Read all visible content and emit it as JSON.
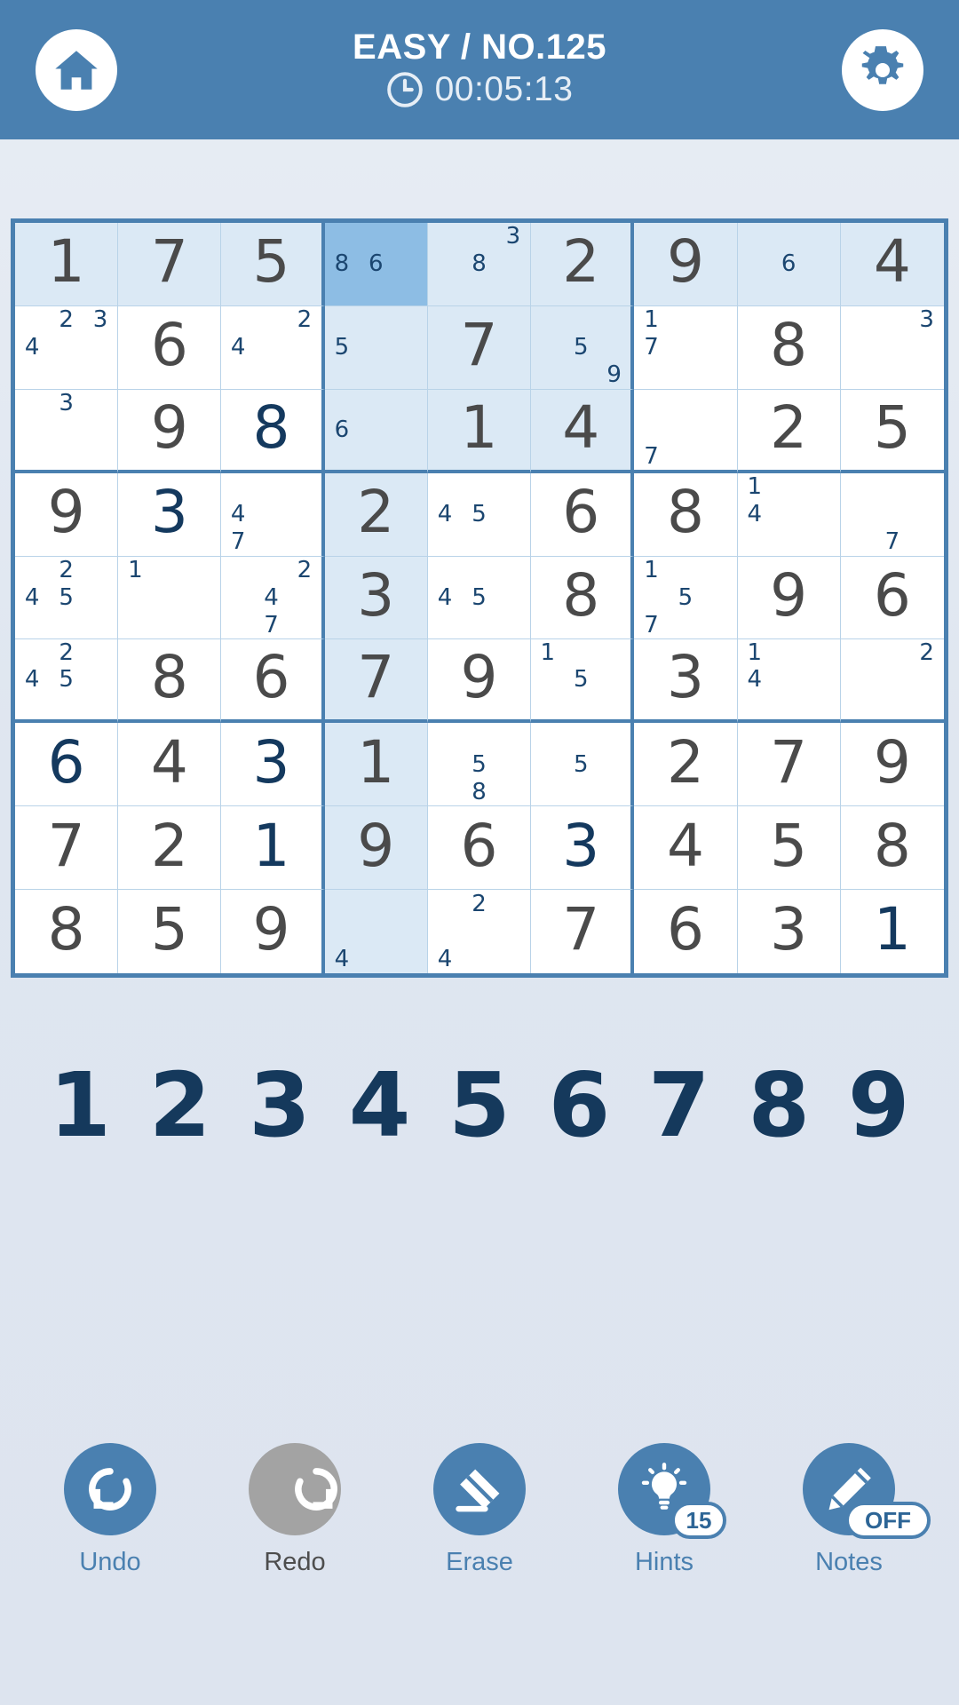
{
  "header": {
    "home_icon": "home-icon",
    "settings_icon": "gear-icon",
    "clock_icon": "clock-icon",
    "title": "EASY / NO.125",
    "timer": "00:05:13"
  },
  "colors": {
    "header_bg": "#4a80b0",
    "grid_border": "#4a80b0",
    "cell_border": "#b9d3e8",
    "peer_highlight": "#dbe9f5",
    "selected": "#8dbde4",
    "given_value": "#4a4a4a",
    "user_value": "#14395e",
    "note": "#1b4670",
    "numpad": "#15395c",
    "disabled": "#a3a3a3"
  },
  "board": {
    "selected_cell": {
      "row": 1,
      "col": 4
    },
    "cells": [
      [
        {
          "v": "1",
          "t": "given"
        },
        {
          "v": "7",
          "t": "given"
        },
        {
          "v": "5",
          "t": "given"
        },
        {
          "notes": [
            null,
            null,
            null,
            "8",
            "6",
            null,
            null,
            null,
            null
          ]
        },
        {
          "notes": [
            null,
            null,
            "3",
            null,
            "8",
            null,
            null,
            null,
            null
          ]
        },
        {
          "v": "2",
          "t": "given"
        },
        {
          "v": "9",
          "t": "given"
        },
        {
          "notes": [
            null,
            null,
            null,
            null,
            "6",
            null,
            null,
            null,
            null
          ]
        },
        {
          "v": "4",
          "t": "given"
        }
      ],
      [
        {
          "notes": [
            null,
            "2",
            "3",
            "4",
            null,
            null,
            null,
            null,
            null
          ]
        },
        {
          "v": "6",
          "t": "given"
        },
        {
          "notes": [
            null,
            null,
            "2",
            "4",
            null,
            null,
            null,
            null,
            null
          ]
        },
        {
          "notes": [
            null,
            null,
            null,
            "5",
            null,
            null,
            null,
            null,
            null
          ]
        },
        {
          "v": "7",
          "t": "given"
        },
        {
          "notes": [
            null,
            null,
            null,
            null,
            "5",
            null,
            null,
            null,
            "9"
          ]
        },
        {
          "notes": [
            "1",
            null,
            null,
            "7",
            null,
            null,
            null,
            null,
            null
          ]
        },
        {
          "v": "8",
          "t": "given"
        },
        {
          "notes": [
            null,
            null,
            "3",
            null,
            null,
            null,
            null,
            null,
            null
          ]
        }
      ],
      [
        {
          "notes": [
            null,
            "3",
            null,
            null,
            null,
            null,
            null,
            null,
            null
          ]
        },
        {
          "v": "9",
          "t": "given"
        },
        {
          "v": "8",
          "t": "user"
        },
        {
          "notes": [
            null,
            null,
            null,
            "6",
            null,
            null,
            null,
            null,
            null
          ]
        },
        {
          "v": "1",
          "t": "given"
        },
        {
          "v": "4",
          "t": "given"
        },
        {
          "notes": [
            null,
            null,
            null,
            null,
            null,
            null,
            "7",
            null,
            null
          ]
        },
        {
          "v": "2",
          "t": "given"
        },
        {
          "v": "5",
          "t": "given"
        }
      ],
      [
        {
          "v": "9",
          "t": "given"
        },
        {
          "v": "3",
          "t": "user"
        },
        {
          "notes": [
            null,
            null,
            null,
            "4",
            null,
            null,
            "7",
            null,
            null
          ]
        },
        {
          "v": "2",
          "t": "given"
        },
        {
          "notes": [
            null,
            null,
            null,
            "4",
            "5",
            null,
            null,
            null,
            null
          ]
        },
        {
          "v": "6",
          "t": "given"
        },
        {
          "v": "8",
          "t": "given"
        },
        {
          "notes": [
            "1",
            null,
            null,
            "4",
            null,
            null,
            null,
            null,
            null
          ]
        },
        {
          "notes": [
            null,
            null,
            null,
            null,
            null,
            null,
            null,
            "7",
            null
          ]
        }
      ],
      [
        {
          "notes": [
            null,
            "2",
            null,
            "4",
            "5",
            null,
            null,
            null,
            null
          ]
        },
        {
          "notes": [
            "1",
            null,
            null,
            null,
            null,
            null,
            null,
            null,
            null
          ]
        },
        {
          "notes": [
            null,
            null,
            "2",
            null,
            "4",
            null,
            null,
            "7",
            null
          ]
        },
        {
          "v": "3",
          "t": "given"
        },
        {
          "notes": [
            null,
            null,
            null,
            "4",
            "5",
            null,
            null,
            null,
            null
          ]
        },
        {
          "v": "8",
          "t": "given"
        },
        {
          "notes": [
            "1",
            null,
            null,
            null,
            "5",
            null,
            "7",
            null,
            null
          ]
        },
        {
          "v": "9",
          "t": "given"
        },
        {
          "v": "6",
          "t": "given"
        }
      ],
      [
        {
          "notes": [
            null,
            "2",
            null,
            "4",
            "5",
            null,
            null,
            null,
            null
          ]
        },
        {
          "v": "8",
          "t": "given"
        },
        {
          "v": "6",
          "t": "given"
        },
        {
          "v": "7",
          "t": "given"
        },
        {
          "v": "9",
          "t": "given"
        },
        {
          "notes": [
            "1",
            null,
            null,
            null,
            "5",
            null,
            null,
            null,
            null
          ]
        },
        {
          "v": "3",
          "t": "given"
        },
        {
          "notes": [
            "1",
            null,
            null,
            "4",
            null,
            null,
            null,
            null,
            null
          ]
        },
        {
          "notes": [
            null,
            null,
            "2",
            null,
            null,
            null,
            null,
            null,
            null
          ]
        }
      ],
      [
        {
          "v": "6",
          "t": "user"
        },
        {
          "v": "4",
          "t": "given"
        },
        {
          "v": "3",
          "t": "user"
        },
        {
          "v": "1",
          "t": "given"
        },
        {
          "notes": [
            null,
            null,
            null,
            null,
            "5",
            null,
            null,
            "8",
            null
          ]
        },
        {
          "notes": [
            null,
            null,
            null,
            null,
            "5",
            null,
            null,
            null,
            null
          ]
        },
        {
          "v": "2",
          "t": "given"
        },
        {
          "v": "7",
          "t": "given"
        },
        {
          "v": "9",
          "t": "given"
        }
      ],
      [
        {
          "v": "7",
          "t": "given"
        },
        {
          "v": "2",
          "t": "given"
        },
        {
          "v": "1",
          "t": "user"
        },
        {
          "v": "9",
          "t": "given"
        },
        {
          "v": "6",
          "t": "given"
        },
        {
          "v": "3",
          "t": "user"
        },
        {
          "v": "4",
          "t": "given"
        },
        {
          "v": "5",
          "t": "given"
        },
        {
          "v": "8",
          "t": "given"
        }
      ],
      [
        {
          "v": "8",
          "t": "given"
        },
        {
          "v": "5",
          "t": "given"
        },
        {
          "v": "9",
          "t": "given"
        },
        {
          "notes": [
            null,
            null,
            null,
            null,
            null,
            null,
            "4",
            null,
            null
          ]
        },
        {
          "notes": [
            null,
            "2",
            null,
            null,
            null,
            null,
            "4",
            null,
            null
          ]
        },
        {
          "v": "7",
          "t": "given"
        },
        {
          "v": "6",
          "t": "given"
        },
        {
          "v": "3",
          "t": "given"
        },
        {
          "v": "1",
          "t": "user"
        }
      ]
    ]
  },
  "numpad": [
    "1",
    "2",
    "3",
    "4",
    "5",
    "6",
    "7",
    "8",
    "9"
  ],
  "actions": [
    {
      "label": "Undo",
      "icon": "undo-icon",
      "state": "enabled",
      "badge": null
    },
    {
      "label": "Redo",
      "icon": "redo-icon",
      "state": "disabled",
      "badge": null
    },
    {
      "label": "Erase",
      "icon": "eraser-icon",
      "state": "enabled",
      "badge": null
    },
    {
      "label": "Hints",
      "icon": "lightbulb-icon",
      "state": "enabled",
      "badge": "15"
    },
    {
      "label": "Notes",
      "icon": "pencil-icon",
      "state": "enabled",
      "badge": "OFF"
    }
  ]
}
